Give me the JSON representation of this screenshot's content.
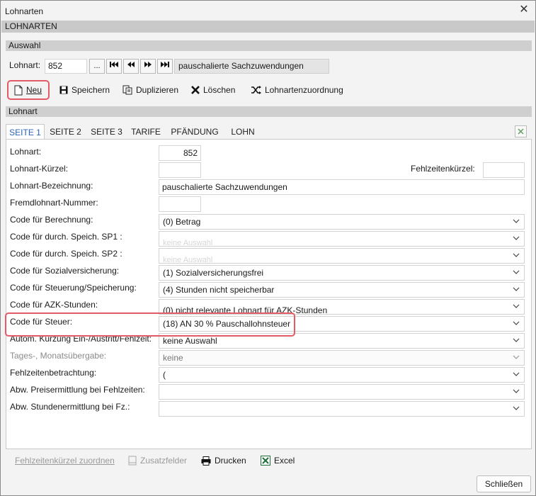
{
  "window": {
    "title": "Lohnarten",
    "close_glyph": "✕"
  },
  "header": {
    "title": "LOHNARTEN"
  },
  "auswahl": {
    "section_title": "Auswahl",
    "label": "Lohnart:",
    "value": "852",
    "nav": [
      "...",
      "⏮",
      "◀◀",
      "▶▶",
      "▶⏭"
    ],
    "name": "pauschalierte Sachzuwendungen"
  },
  "toolbar": {
    "new": "Neu",
    "save": "Speichern",
    "duplicate": "Duplizieren",
    "delete": "Löschen",
    "assign": "Lohnartenzuordnung"
  },
  "lohnart": {
    "section_title": "Lohnart",
    "tabs": [
      "SEITE 1",
      "SEITE 2",
      "SEITE 3",
      "TARIFE",
      "PFÄNDUNG",
      "LOHN"
    ],
    "active_tab": "SEITE 1",
    "fields": {
      "lohnart_label": "Lohnart:",
      "lohnart_value": "852",
      "kuerzel_label": "Lohnart-Kürzel:",
      "kuerzel_value": "",
      "fehlzeiten_label": "Fehlzeitenkürzel:",
      "fehlzeiten_value": "",
      "bezeichnung_label": "Lohnart-Bezeichnung:",
      "bezeichnung_value": "pauschalierte Sachzuwendungen",
      "fremd_label": "Fremdlohnart-Nummer:",
      "fremd_value": ""
    },
    "rows": [
      {
        "label": "Code für Berechnung:",
        "value": "(0) Betrag",
        "disabled": false
      },
      {
        "label": "Code für durch. Speich. SP1 :",
        "value": "keine Auswahl",
        "disabled": false,
        "clipped": true
      },
      {
        "label": "Code für durch. Speich. SP2 :",
        "value": "keine Auswahl",
        "disabled": false,
        "clipped": true
      },
      {
        "label": "Code für Sozialversicherung:",
        "value": "(1) Sozialversicherungsfrei",
        "disabled": false
      },
      {
        "label": "Code für Steuerung/Speicherung:",
        "value": "(4) Stunden nicht speicherbar",
        "disabled": false
      },
      {
        "label": "Code für AZK-Stunden:",
        "value": "(0) nicht relevante Lohnart für AZK-Stunden",
        "disabled": false,
        "clipped": true
      },
      {
        "label": "Code für Steuer:",
        "value": "(18) AN 30 % Pauschallohnsteuer",
        "disabled": false
      },
      {
        "label": "Autom. Kürzung Ein-/Austritt/Fehlzeit:",
        "value": "keine Auswahl",
        "disabled": false
      },
      {
        "label": "Tages-, Monatsübergabe:",
        "value": "keine",
        "disabled": true
      },
      {
        "label": "Fehlzeitenbetrachtung:",
        "value": "(",
        "disabled": false
      },
      {
        "label": "Abw. Preisermittlung bei Fehlzeiten:",
        "value": "",
        "disabled": false
      },
      {
        "label": "Abw. Stundenermittlung bei Fz.:",
        "value": "",
        "disabled": false
      }
    ]
  },
  "bottom": {
    "fehlzeiten_assign": "Fehlzeitenkürzel zuordnen",
    "zusatzfelder": "Zusatzfelder",
    "drucken": "Drucken",
    "excel": "Excel",
    "close": "Schließen"
  },
  "colors": {
    "highlight": "#e35b64",
    "active_tab": "#2a64b7",
    "section_bg": "#cfcfcf"
  }
}
